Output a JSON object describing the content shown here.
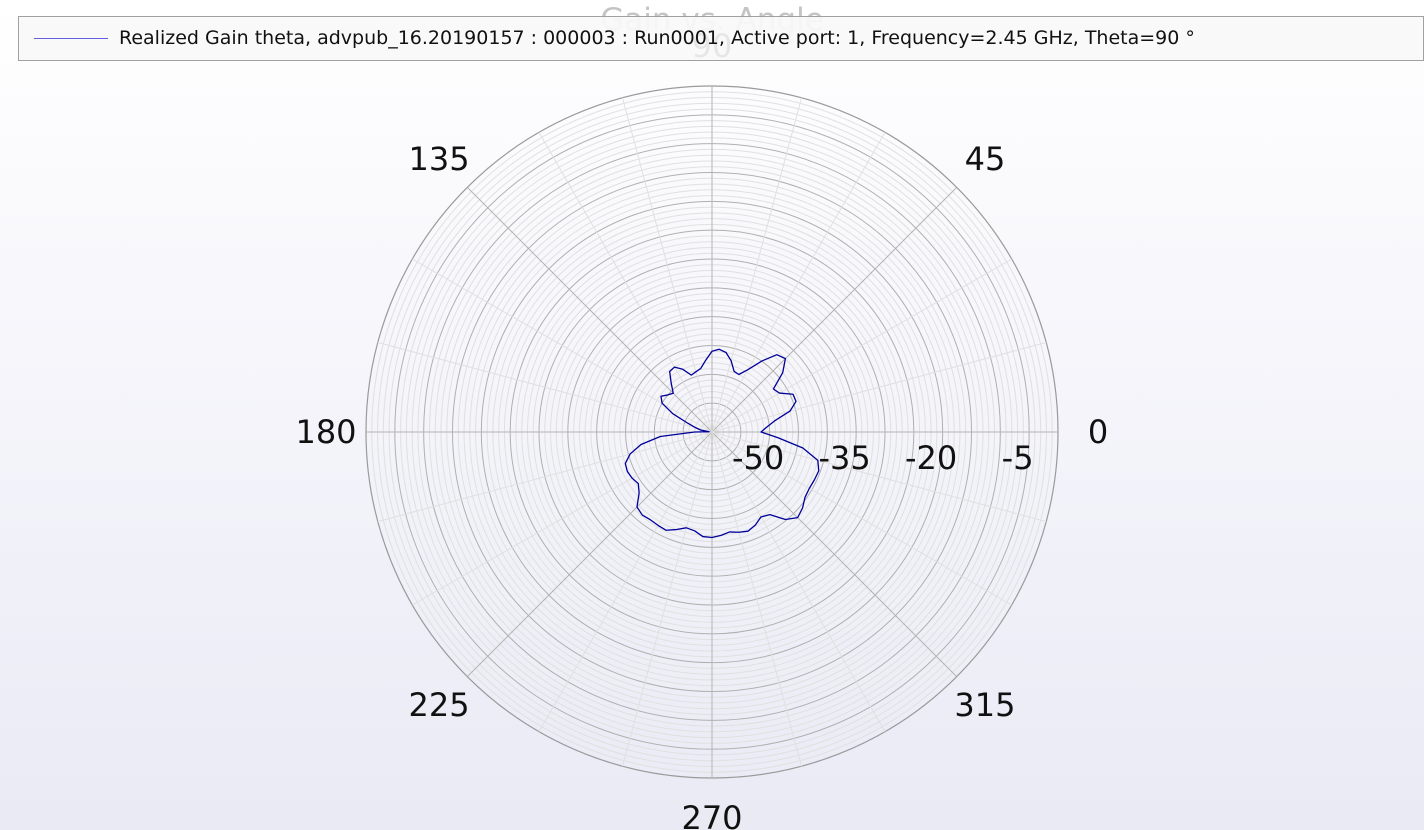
{
  "chart_data": {
    "type": "polar-line",
    "title": "Gain vs. Angle",
    "angle_ticks": [
      "0",
      "45",
      "90",
      "135",
      "180",
      "225",
      "270",
      "315"
    ],
    "angle_tick_values": [
      0,
      45,
      90,
      135,
      180,
      225,
      270,
      315
    ],
    "radial_ticks": [
      "-50",
      "-35",
      "-20",
      "-5"
    ],
    "radial_tick_values": [
      -50,
      -35,
      -20,
      -5
    ],
    "rlim": [
      -58,
      2
    ],
    "grid": true,
    "legend_position": "top",
    "series": [
      {
        "name": "Realized Gain theta, advpub_16.20190157 : 000003 : Run0001, Active port: 1, Frequency=2.45 GHz, Theta=90 °",
        "color": "#000099",
        "angles": [
          0,
          5,
          10,
          15,
          20,
          25,
          30,
          35,
          40,
          45,
          50,
          55,
          60,
          65,
          70,
          75,
          80,
          85,
          90,
          95,
          100,
          105,
          110,
          115,
          120,
          125,
          130,
          135,
          140,
          145,
          150,
          155,
          160,
          165,
          170,
          175,
          180,
          185,
          190,
          195,
          200,
          205,
          210,
          215,
          220,
          225,
          230,
          235,
          240,
          245,
          250,
          255,
          260,
          265,
          270,
          275,
          280,
          285,
          290,
          295,
          300,
          305,
          310,
          315,
          320,
          325,
          330,
          335,
          340,
          345,
          350,
          355
        ],
        "values": [
          -49.5,
          -48.5,
          -47.0,
          -44.0,
          -42.5,
          -42.5,
          -44.5,
          -45.0,
          -42.0,
          -40.0,
          -40.5,
          -43.0,
          -45.5,
          -47.0,
          -46.8,
          -45.2,
          -44.0,
          -43.6,
          -44.0,
          -45.5,
          -46.8,
          -47.2,
          -47.5,
          -46.0,
          -45.0,
          -45.2,
          -47.0,
          -48.5,
          -48.0,
          -47.2,
          -48.0,
          -50.5,
          -53.5,
          -55.0,
          -56.0,
          -57.5,
          -55.0,
          -49.0,
          -45.5,
          -43.3,
          -42.0,
          -41.8,
          -42.0,
          -42.4,
          -41.5,
          -39.6,
          -39.2,
          -39.4,
          -39.3,
          -39.2,
          -40.0,
          -40.8,
          -40.6,
          -39.8,
          -39.7,
          -40.0,
          -40.4,
          -40.0,
          -39.7,
          -40.2,
          -41.0,
          -40.5,
          -38.2,
          -37.0,
          -37.5,
          -38.3,
          -38.5,
          -38.4,
          -38.3,
          -39.0,
          -42.0,
          -46.5
        ]
      }
    ]
  }
}
